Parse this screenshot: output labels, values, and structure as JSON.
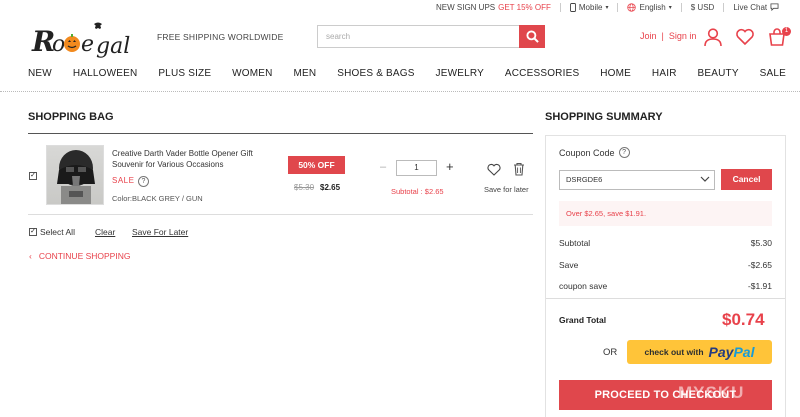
{
  "topbar": {
    "signup_text": "NEW SIGN UPS",
    "signup_offer": "GET 15% OFF",
    "mobile": "Mobile",
    "language": "English",
    "currency": "$ USD",
    "live_chat": "Live Chat"
  },
  "header": {
    "logo_text": "Rosegal",
    "tagline": "FREE SHIPPING WORLDWIDE",
    "search_placeholder": "search",
    "join": "Join",
    "sign_in": "Sign in",
    "cart_count": "1"
  },
  "nav": [
    "NEW",
    "HALLOWEEN",
    "PLUS SIZE",
    "WOMEN",
    "MEN",
    "SHOES & BAGS",
    "JEWELRY",
    "ACCESSORIES",
    "HOME",
    "HAIR",
    "BEAUTY",
    "SALE"
  ],
  "bag": {
    "title": "SHOPPING BAG",
    "item": {
      "checked": true,
      "name": "Creative Darth Vader Bottle Opener Gift Souvenir for Various Occasions",
      "sale_tag": "SALE",
      "color": "Color:BLACK GREY / GUN",
      "discount": "50% OFF",
      "old_price": "$5.30",
      "new_price": "$2.65",
      "quantity": "1",
      "subtotal": "Subtotal : $2.65",
      "save_for_later": "Save for later"
    },
    "select_all": "Select All",
    "clear": "Clear",
    "save_for_later_link": "Save For Later",
    "continue_shopping": "CONTINUE SHOPPING"
  },
  "summary": {
    "title": "SHOPPING SUMMARY",
    "coupon_label": "Coupon Code",
    "coupon_value": "DSRGDE6",
    "cancel": "Cancel",
    "notice": "Over $2.65, save $1.91.",
    "rows": [
      {
        "label": "Subtotal",
        "value": "$5.30"
      },
      {
        "label": "Save",
        "value": "-$2.65"
      },
      {
        "label": "coupon save",
        "value": "-$1.91"
      }
    ],
    "grand_total_label": "Grand Total",
    "grand_total_value": "$0.74",
    "or": "OR",
    "paypal_prefix": "check out with",
    "paypal_pay": "Pay",
    "paypal_pal": "Pal",
    "checkout": "PROCEED TO CHECKOUT",
    "watermark": "MYSKU"
  },
  "colors": {
    "accent": "#e0474c",
    "paypal_yellow": "#ffc439"
  }
}
